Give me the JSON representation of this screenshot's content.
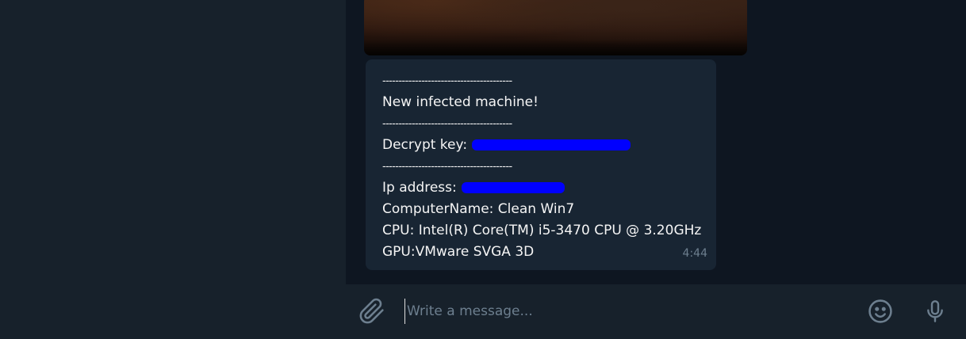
{
  "message": {
    "separator": "----------------------------------------",
    "title": "New infected machine!",
    "decrypt_label": "Decrypt key:",
    "ip_label": "Ip address:",
    "computer_name": "ComputerName: Clean Win7",
    "cpu": "CPU: Intel(R) Core(TM) i5-3470 CPU @ 3.20GHz",
    "gpu": "GPU:VMware SVGA 3D",
    "time": "4:44"
  },
  "composer": {
    "placeholder": "Write a message..."
  },
  "icons": {
    "attach": "paperclip-icon",
    "emoji": "emoji-icon",
    "mic": "microphone-icon"
  },
  "colors": {
    "background": "#0e1621",
    "panel": "#17212b",
    "bubble": "#182533",
    "redaction": "#0000ff",
    "muted": "#6d7f8f"
  }
}
